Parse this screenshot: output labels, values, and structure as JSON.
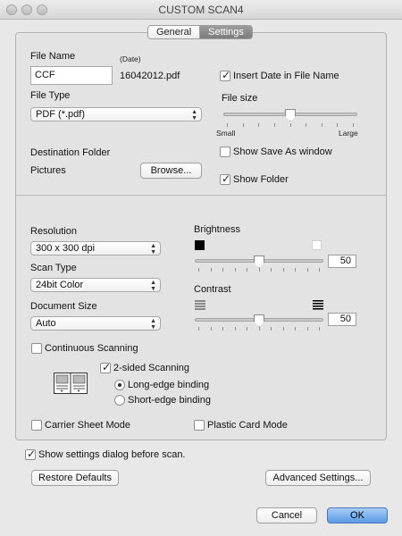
{
  "window": {
    "title": "CUSTOM SCAN4"
  },
  "tabs": [
    {
      "label": "General",
      "active": false
    },
    {
      "label": "Settings",
      "active": true
    }
  ],
  "file": {
    "name_label": "File Name",
    "date_label": "(Date)",
    "name_value": "CCF",
    "date_filename": "16042012.pdf",
    "insert_date_label": "Insert Date in File Name",
    "insert_date_checked": true,
    "type_label": "File Type",
    "type_value": "PDF (*.pdf)",
    "size_label": "File size",
    "size_small": "Small",
    "size_large": "Large",
    "size_level": 0.5
  },
  "destination": {
    "label": "Destination Folder",
    "value": "Pictures",
    "browse_label": "Browse...",
    "show_save_as_label": "Show Save As window",
    "show_save_as_checked": false,
    "show_folder_label": "Show Folder",
    "show_folder_checked": true
  },
  "scan": {
    "resolution_label": "Resolution",
    "resolution_value": "300 x 300 dpi",
    "type_label": "Scan Type",
    "type_value": "24bit Color",
    "doc_size_label": "Document Size",
    "doc_size_value": "Auto",
    "brightness_label": "Brightness",
    "brightness_value": "50",
    "contrast_label": "Contrast",
    "contrast_value": "50",
    "continuous_label": "Continuous Scanning",
    "continuous_checked": false,
    "two_sided_label": "2-sided Scanning",
    "two_sided_checked": true,
    "long_edge_label": "Long-edge binding",
    "short_edge_label": "Short-edge binding",
    "binding": "long",
    "carrier_label": "Carrier Sheet Mode",
    "carrier_checked": false,
    "plastic_label": "Plastic Card Mode",
    "plastic_checked": false
  },
  "footer": {
    "show_dialog_label": "Show settings dialog before scan.",
    "show_dialog_checked": true,
    "restore_label": "Restore Defaults",
    "advanced_label": "Advanced Settings...",
    "cancel_label": "Cancel",
    "ok_label": "OK"
  },
  "icons": {
    "close": "traffic-light-close",
    "minimize": "traffic-light-minimize",
    "zoom": "traffic-light-zoom",
    "brightness_low": "black-square",
    "brightness_high": "white-square",
    "contrast_low": "low-contrast-lines",
    "contrast_high": "high-contrast-lines",
    "duplex": "duplex-pages-illustration"
  }
}
